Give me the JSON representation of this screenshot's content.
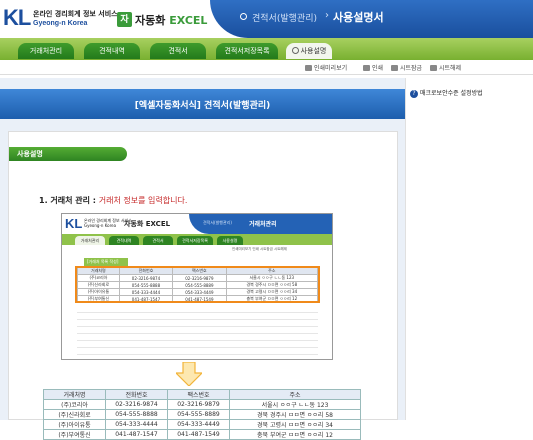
{
  "header": {
    "logo_letters": "KL",
    "logo_line1": "온라인 경리회계 정보 서비스",
    "logo_line2": "Gyeong-n Korea",
    "excel_badge": "자",
    "excel_prefix": "자동화",
    "excel_word": "EXCEL",
    "breadcrumb": "견적서(발행관리)",
    "separator": "›",
    "title": "사용설명서"
  },
  "nav": {
    "tabs": [
      {
        "label": "거래처관리"
      },
      {
        "label": "견적내역"
      },
      {
        "label": "견적서"
      },
      {
        "label": "견적서저장목록"
      },
      {
        "label": "사용설명"
      }
    ]
  },
  "toolbar": {
    "items": [
      {
        "label": "인쇄미리보기"
      },
      {
        "label": "인쇄"
      },
      {
        "label": "시트잠금"
      },
      {
        "label": "시트해제"
      }
    ]
  },
  "sidebar": {
    "help_label": "매크로보안수준 설정방법"
  },
  "banner": {
    "title": "[엑셀자동화서식] 견적서(발행관리)"
  },
  "section": {
    "title": "사용설명"
  },
  "step1": {
    "number": "1.",
    "heading": "거래처 관리 :",
    "desc": "거래처 정보를 입력합니다."
  },
  "mini_screenshot": {
    "logo_letters": "KL",
    "logo_line1": "온라인 경리회계 정보 서비스",
    "logo_line2": "Gyeong-n Korea",
    "excel": "자동화 EXCEL",
    "breadcrumb": "견적서(발행관리)",
    "title": "거래처관리",
    "tabs": [
      "거래처관리",
      "견적내역",
      "견적서",
      "견적서저장목록",
      "사용설명"
    ],
    "toolbar": "인쇄미리보기  인쇄  시트잠금  시트해제",
    "sub_button": "[거래처 목록 작성]"
  },
  "table": {
    "columns": [
      "거래처명",
      "전화번호",
      "팩스번호",
      "주소"
    ],
    "rows": [
      [
        "(주)코리아",
        "02-3216-9874",
        "02-3216-9879",
        "서울시 ㅇㅇ구 ㄴㄴ동 123"
      ],
      [
        "(주)신라회로",
        "054-555-8888",
        "054-555-8889",
        "경북 경주시 ㅁㅁ면 ㅇㅇ리 58"
      ],
      [
        "(주)아이유통",
        "054-333-4444",
        "054-333-4449",
        "경북 고령시 ㅁㅁ면 ㅇㅇ리 34"
      ],
      [
        "(주)부여통신",
        "041-487-1547",
        "041-487-1549",
        "충북 부여군 ㅁㅁ면 ㅇㅇ리 12"
      ]
    ]
  },
  "colors": {
    "header_blue": "#1a4f9e",
    "nav_green": "#78b030",
    "tab_green": "#237a1b",
    "highlight_orange": "#f08a1a",
    "accent_red": "#c62828"
  }
}
